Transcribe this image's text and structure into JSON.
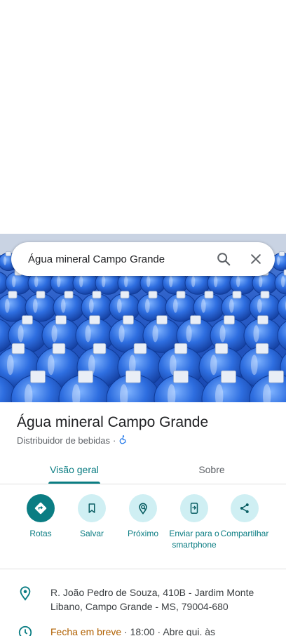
{
  "search": {
    "query": "Água mineral Campo Grande"
  },
  "place": {
    "title": "Água mineral Campo Grande",
    "category": "Distribuidor de bebidas",
    "separator": "·"
  },
  "tabs": [
    {
      "label": "Visão geral",
      "active": true
    },
    {
      "label": "Sobre",
      "active": false
    }
  ],
  "actions": [
    {
      "label": "Rotas",
      "icon": "directions-icon"
    },
    {
      "label": "Salvar",
      "icon": "bookmark-icon"
    },
    {
      "label": "Próximo",
      "icon": "nearby-icon"
    },
    {
      "label": "Enviar para o smartphone",
      "icon": "send-to-phone-icon"
    },
    {
      "label": "Compartilhar",
      "icon": "share-icon"
    }
  ],
  "details": {
    "address": "R. João Pedro de Souza, 410B - Jardim Monte Libano, Campo Grande - MS, 79004-680",
    "hours_status": "Fecha em breve",
    "hours_rest": " · 18:00 · Abre qui. às"
  },
  "colors": {
    "accent": "#0b7d83",
    "accent_light": "#cfeff3",
    "warning": "#b06000",
    "accessibility": "#1a73e8"
  }
}
